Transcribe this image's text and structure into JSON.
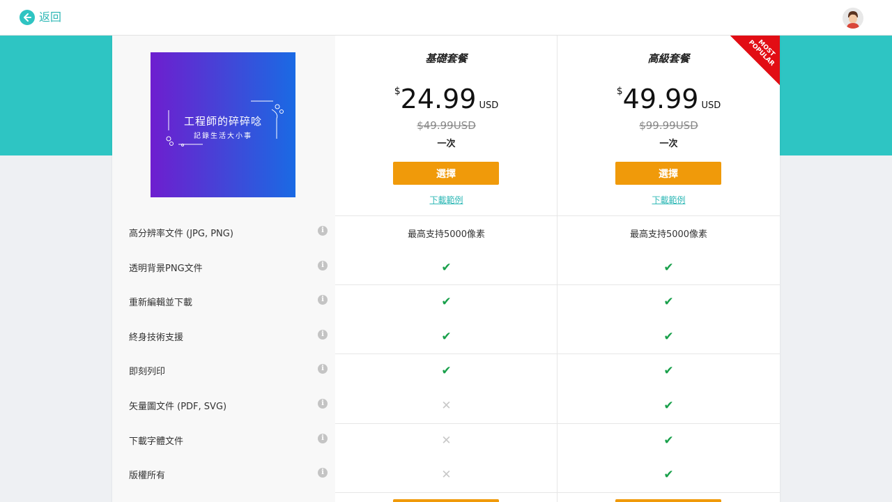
{
  "header": {
    "back_label": "返回",
    "back_icon": "arrow-left-icon",
    "avatar_icon": "user-avatar-icon"
  },
  "preview": {
    "title": "工程師的碎碎唸",
    "subtitle": "記錄生活大小事"
  },
  "plans": [
    {
      "name": "基礎套餐",
      "currency_symbol": "$",
      "price": "24.99",
      "unit": "USD",
      "original_price": "$49.99USD",
      "period": "一次",
      "select_label": "選擇",
      "sample_label": "下載範例"
    },
    {
      "name": "高級套餐",
      "currency_symbol": "$",
      "price": "49.99",
      "unit": "USD",
      "original_price": "$99.99USD",
      "period": "一次",
      "select_label": "選擇",
      "sample_label": "下載範例"
    }
  ],
  "ribbon": {
    "line1": "MOST",
    "line2": "POPULAR"
  },
  "features": [
    {
      "label": "高分辨率文件 (JPG, PNG)",
      "basic": "最高支持5000像素",
      "advanced": "最高支持5000像素"
    },
    {
      "label": "透明背景PNG文件",
      "basic": "check",
      "advanced": "check"
    },
    {
      "label": "重新編輯並下載",
      "basic": "check",
      "advanced": "check"
    },
    {
      "label": "終身技術支援",
      "basic": "check",
      "advanced": "check"
    },
    {
      "label": "即刻列印",
      "basic": "check",
      "advanced": "check"
    },
    {
      "label": "矢量圖文件 (PDF, SVG)",
      "basic": "cross",
      "advanced": "check"
    },
    {
      "label": "下載字體文件",
      "basic": "cross",
      "advanced": "check"
    },
    {
      "label": "版權所有",
      "basic": "cross",
      "advanced": "check"
    }
  ],
  "symbols": {
    "info": "i",
    "check": "✔",
    "cross": "✕"
  },
  "colors": {
    "teal": "#2ec5c3",
    "orange": "#f09a0a",
    "check_green": "#19a04b",
    "ribbon_red": "#e20d14"
  }
}
